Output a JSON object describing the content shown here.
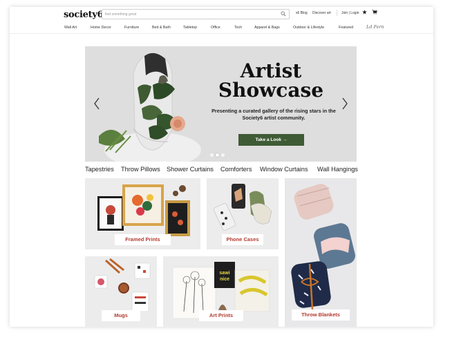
{
  "header": {
    "logo": "society6",
    "search_placeholder": "find something great",
    "blog": "s6 Blog",
    "discover": "Discover art",
    "join": "Join | Login"
  },
  "nav": {
    "items": [
      "Wall Art",
      "Home Decor",
      "Furniture",
      "Bed & Bath",
      "Tabletop",
      "Office",
      "Tech",
      "Apparel & Bags",
      "Outdoor & Lifestyle",
      "Featured"
    ],
    "signature": "Ld Fern"
  },
  "hero": {
    "title": "Artist\nShowcase",
    "subtitle": "Presenting a curated gallery of the rising stars in the Society6 artist community.",
    "cta": "Take a Look →",
    "colors": {
      "cta_bg": "#3f5b35",
      "background": "#dedede"
    }
  },
  "categories": [
    "Tapestries",
    "Throw Pillows",
    "Shower Curtains",
    "Comforters",
    "Window Curtains",
    "Wall Hangings"
  ],
  "tiles": {
    "framed_prints": "Framed Prints",
    "phone_cases": "Phone Cases",
    "throw_blankets": "Throw Blankets",
    "mugs": "Mugs",
    "art_prints": "Art Prints",
    "label_color": "#b33a2e"
  }
}
